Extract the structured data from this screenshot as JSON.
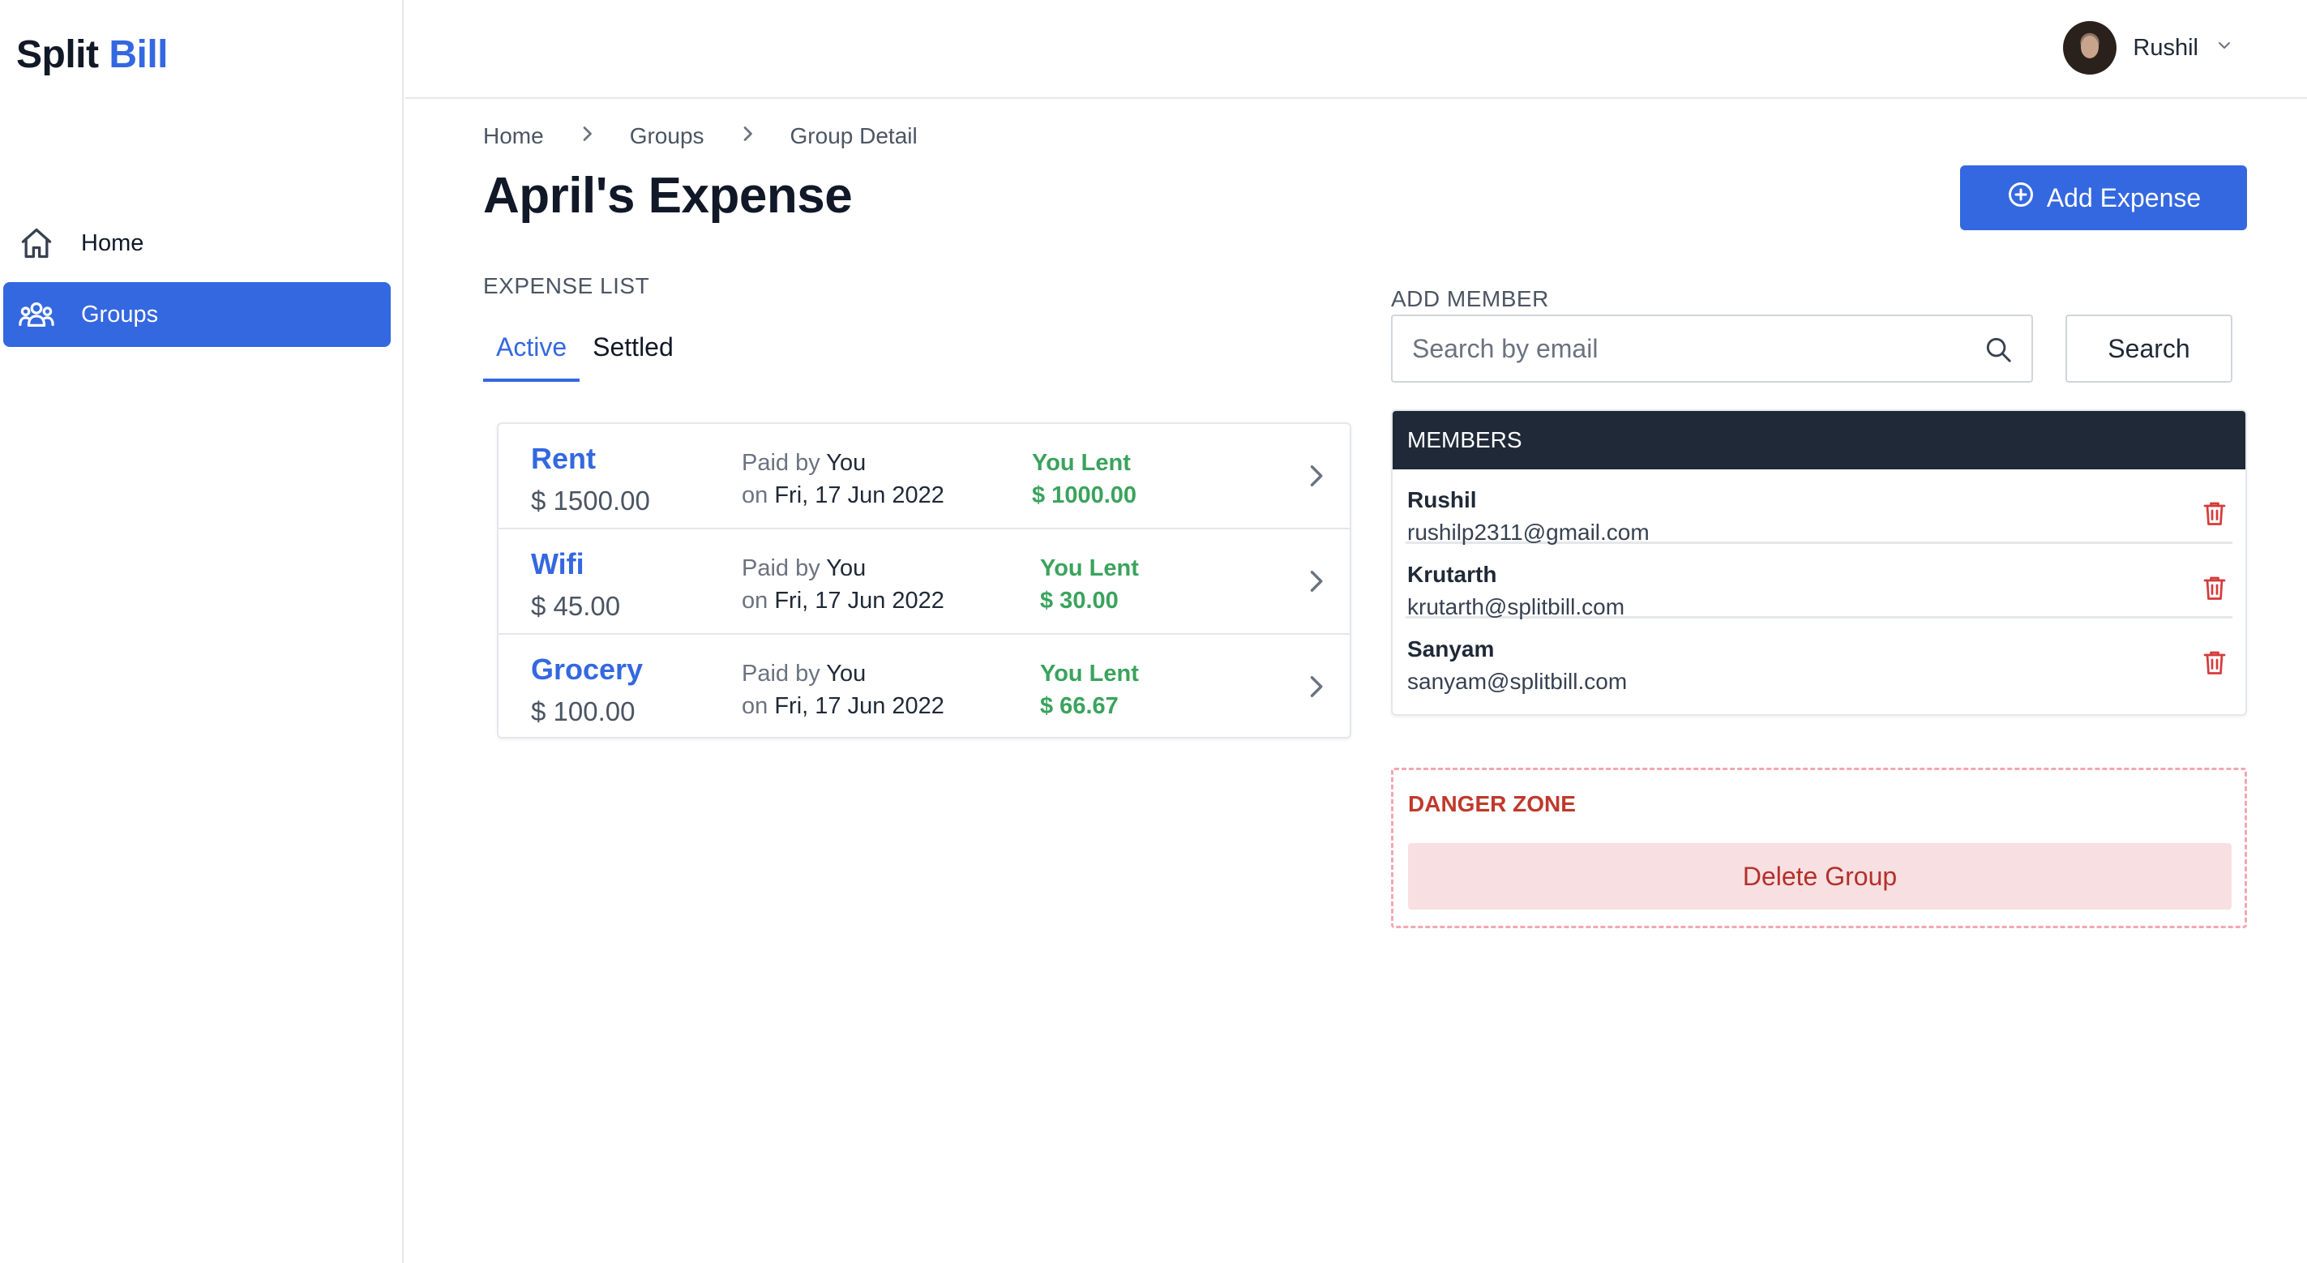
{
  "app": {
    "brand_part1": "Split",
    "brand_part2": "Bill",
    "brand_accent_color": "#3468e0"
  },
  "sidebar": {
    "items": [
      {
        "label": "Home",
        "icon": "home-icon",
        "active": false
      },
      {
        "label": "Groups",
        "icon": "users-icon",
        "active": true
      }
    ]
  },
  "header": {
    "user_name": "Rushil"
  },
  "breadcrumb": [
    "Home",
    "Groups",
    "Group Detail"
  ],
  "page": {
    "title": "April's Expense",
    "add_expense_label": "Add Expense"
  },
  "expense_list": {
    "section_label": "EXPENSE LIST",
    "tabs": [
      {
        "label": "Active",
        "active": true
      },
      {
        "label": "Settled",
        "active": false
      }
    ],
    "items": [
      {
        "name": "Rent",
        "amount": "$ 1500.00",
        "paid_by_prefix": "Paid by",
        "paid_by": "You",
        "date_prefix": "on",
        "date": "Fri, 17 Jun 2022",
        "status": "You Lent",
        "lent_amount": "$ 1000.00"
      },
      {
        "name": "Wifi",
        "amount": "$ 45.00",
        "paid_by_prefix": "Paid by",
        "paid_by": "You",
        "date_prefix": "on",
        "date": "Fri, 17 Jun 2022",
        "status": "You Lent",
        "lent_amount": "$ 30.00"
      },
      {
        "name": "Grocery",
        "amount": "$ 100.00",
        "paid_by_prefix": "Paid by",
        "paid_by": "You",
        "date_prefix": "on",
        "date": "Fri, 17 Jun 2022",
        "status": "You Lent",
        "lent_amount": "$ 66.67"
      }
    ]
  },
  "add_member": {
    "section_label": "ADD MEMBER",
    "search_placeholder": "Search by email",
    "search_button": "Search"
  },
  "members": {
    "header": "MEMBERS",
    "list": [
      {
        "name": "Rushil",
        "email": "rushilp2311@gmail.com"
      },
      {
        "name": "Krutarth",
        "email": "krutarth@splitbill.com"
      },
      {
        "name": "Sanyam",
        "email": "sanyam@splitbill.com"
      }
    ]
  },
  "danger_zone": {
    "title": "DANGER ZONE",
    "delete_label": "Delete Group"
  },
  "colors": {
    "primary": "#3468e0",
    "lent_green": "#3aa35c",
    "danger_red": "#c0392b",
    "members_header_bg": "#1f2937"
  }
}
